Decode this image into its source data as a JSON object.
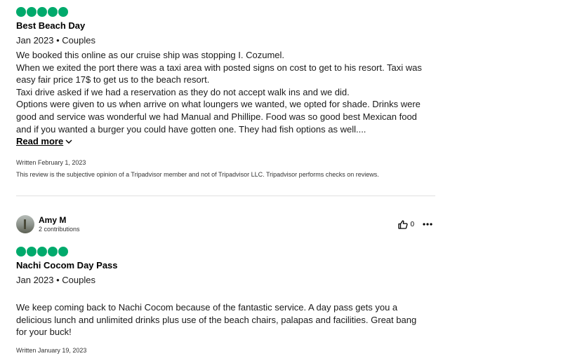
{
  "review1": {
    "rating": 5,
    "title": "Best Beach Day",
    "meta": "Jan 2023 • Couples",
    "lines": [
      "We booked this online as our cruise ship was stopping I. Cozumel.",
      "When we exited the port there was a taxi area with posted signs on cost to get to his resort. Taxi was",
      "easy fair price 17$ to get us to the beach resort.",
      "Taxi drive asked if we had a reservation as they do not accept walk ins and we did.",
      "Options were given to us when arrive on what loungers we wanted, we opted for shade. Drinks were",
      "good and service was wonderful we had Manual and Phillipe. Food was so good best Mexican food",
      "and if you wanted a burger you could have gotten one. They had fish options as well...."
    ],
    "read_more": "Read more",
    "written": "Written February 1, 2023",
    "disclaimer": "This review is the subjective opinion of a Tripadvisor member and not of Tripadvisor LLC. Tripadvisor performs checks on reviews."
  },
  "review2": {
    "user_name": "Amy M",
    "contributions": "2 contributions",
    "helpful_count": "0",
    "rating": 5,
    "title": "Nachi Cocom Day Pass",
    "meta": "Jan 2023 • Couples",
    "lines": [
      "We keep coming back to Nachi Cocom because of the fantastic service. A day pass gets you a",
      "delicious lunch and unlimited drinks plus use of the beach chairs, palapas and facilities. Great bang",
      "for your buck!"
    ],
    "written": "Written January 19, 2023"
  },
  "icons": {
    "rating": "bubble-rating-icon",
    "thumbs_up": "thumbs-up-icon",
    "more": "more-options-icon",
    "chevron": "chevron-down-icon"
  },
  "colors": {
    "bubble": "#00aa6c"
  }
}
